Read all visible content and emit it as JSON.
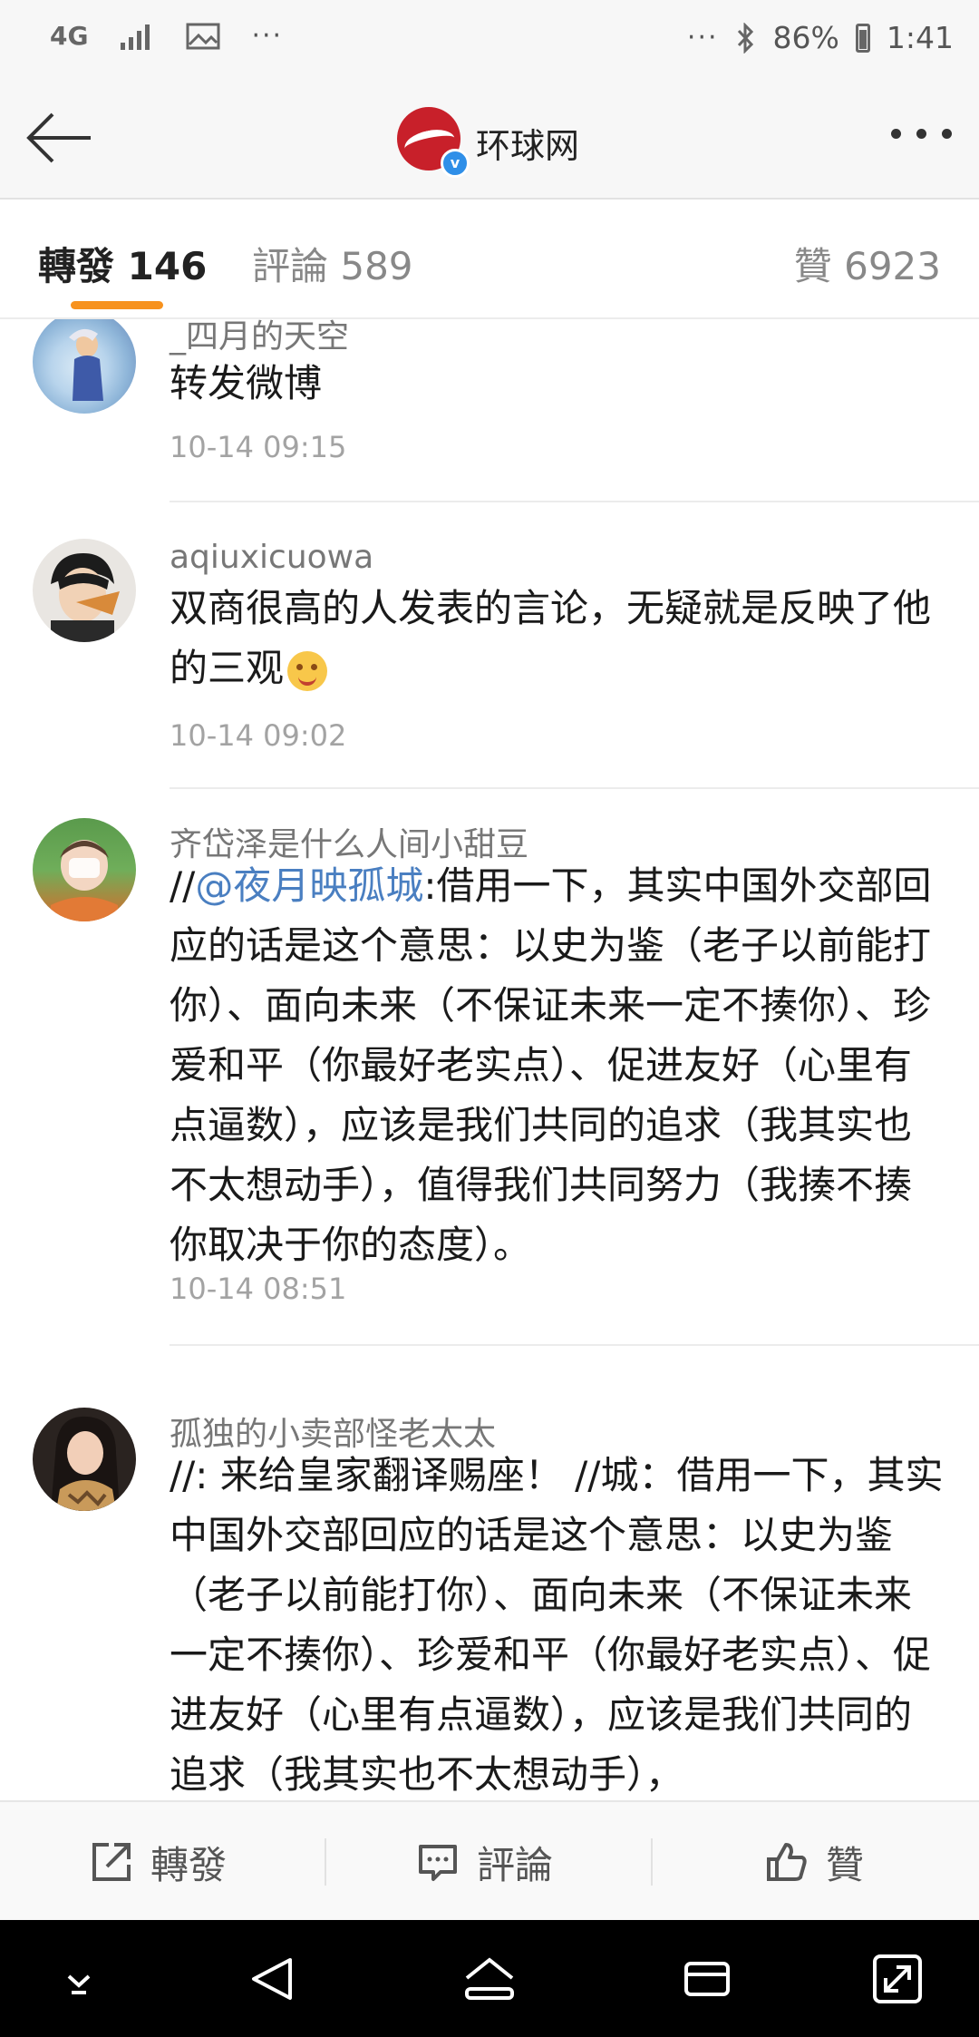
{
  "status_bar": {
    "network": "4G",
    "overflow": "···",
    "battery": "86%",
    "time": "1:41"
  },
  "header": {
    "title": "环球网",
    "verified_mark": "v"
  },
  "tabs": {
    "repost": "轉發 146",
    "comment": "評論 589",
    "like": "贊 6923"
  },
  "reposts": [
    {
      "user": "_四月的天空",
      "text": "转发微博",
      "time": "10-14 09:15"
    },
    {
      "user": "aqiuxicuowa",
      "text": "双商很高的人发表的言论，无疑就是反映了他的三观",
      "time": "10-14 09:02"
    },
    {
      "user": "齐岱泽是什么人间小甜豆",
      "prefix": "//",
      "mention": "@夜月映孤城",
      "text": ":借用一下，其实中国外交部回应的话是这个意思：以史为鉴（老子以前能打你）、面向未来（不保证未来一定不揍你）、珍爱和平（你最好老实点）、促进友好（心里有点逼数），应该是我们共同的追求（我其实也不太想动手），值得我们共同努力（我揍不揍你取决于你的态度）。",
      "time": "10-14 08:51"
    },
    {
      "user": "孤独的小卖部怪老太太",
      "text": "//: 来给皇家翻译赐座！ //城：借用一下，其实中国外交部回应的话是这个意思：以史为鉴（老子以前能打你）、面向未来（不保证未来一定不揍你）、珍爱和平（你最好老实点）、促进友好（心里有点逼数），应该是我们共同的追求（我其实也不太想动手），"
    }
  ],
  "actions": {
    "repost": "轉發",
    "comment": "評論",
    "like": "贊"
  },
  "colors": {
    "accent": "#f7921e",
    "mention": "#4a7fc1",
    "brand": "#c8202a"
  }
}
